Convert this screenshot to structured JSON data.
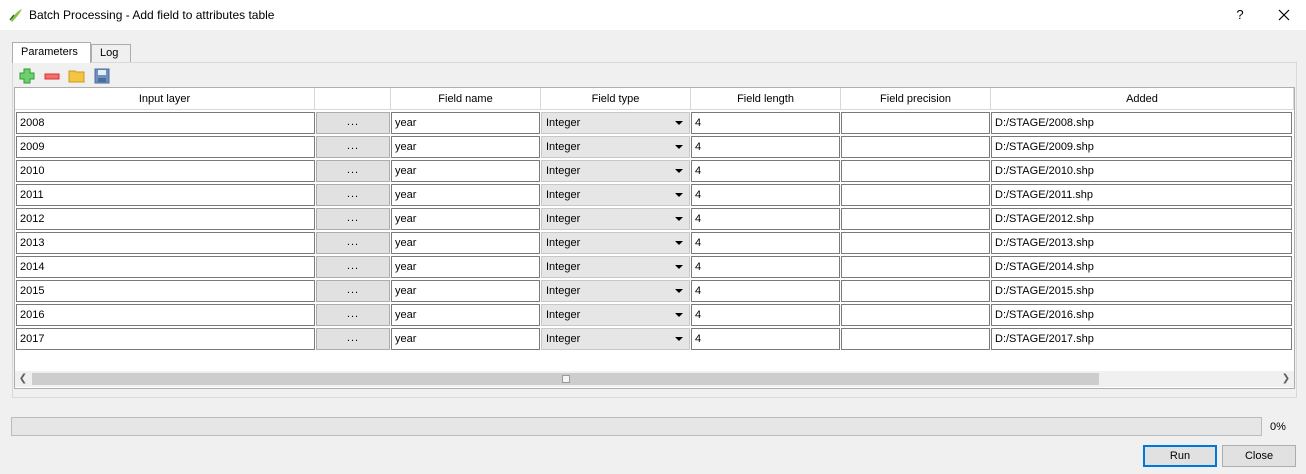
{
  "window": {
    "title": "Batch Processing - Add field to attributes table",
    "help_label": "?",
    "close_label": "✕"
  },
  "tabs": [
    {
      "label": "Parameters",
      "active": true
    },
    {
      "label": "Log",
      "active": false
    }
  ],
  "toolbar": {
    "icons": [
      "add-row-icon",
      "remove-row-icon",
      "open-folder-icon",
      "save-icon"
    ]
  },
  "table": {
    "columns": [
      "Input layer",
      "",
      "Field name",
      "Field type",
      "Field length",
      "Field precision",
      "Added"
    ],
    "browse_label": "...",
    "rows": [
      {
        "input": "2008",
        "field_name": "year",
        "field_type": "Integer",
        "field_length": "4",
        "field_precision": "",
        "added": "D:/STAGE/2008.shp"
      },
      {
        "input": "2009",
        "field_name": "year",
        "field_type": "Integer",
        "field_length": "4",
        "field_precision": "",
        "added": "D:/STAGE/2009.shp"
      },
      {
        "input": "2010",
        "field_name": "year",
        "field_type": "Integer",
        "field_length": "4",
        "field_precision": "",
        "added": "D:/STAGE/2010.shp"
      },
      {
        "input": "2011",
        "field_name": "year",
        "field_type": "Integer",
        "field_length": "4",
        "field_precision": "",
        "added": "D:/STAGE/2011.shp"
      },
      {
        "input": "2012",
        "field_name": "year",
        "field_type": "Integer",
        "field_length": "4",
        "field_precision": "",
        "added": "D:/STAGE/2012.shp"
      },
      {
        "input": "2013",
        "field_name": "year",
        "field_type": "Integer",
        "field_length": "4",
        "field_precision": "",
        "added": "D:/STAGE/2013.shp"
      },
      {
        "input": "2014",
        "field_name": "year",
        "field_type": "Integer",
        "field_length": "4",
        "field_precision": "",
        "added": "D:/STAGE/2014.shp"
      },
      {
        "input": "2015",
        "field_name": "year",
        "field_type": "Integer",
        "field_length": "4",
        "field_precision": "",
        "added": "D:/STAGE/2015.shp"
      },
      {
        "input": "2016",
        "field_name": "year",
        "field_type": "Integer",
        "field_length": "4",
        "field_precision": "",
        "added": "D:/STAGE/2016.shp"
      },
      {
        "input": "2017",
        "field_name": "year",
        "field_type": "Integer",
        "field_length": "4",
        "field_precision": "",
        "added": "D:/STAGE/2017.shp"
      }
    ]
  },
  "progress": {
    "value": 0,
    "text": "0%"
  },
  "buttons": {
    "run_label": "Run",
    "close_label": "Close"
  },
  "colors": {
    "accent": "#0078d7",
    "add_icon": "#2d9d2d",
    "remove_icon": "#e03030",
    "folder_icon": "#f4c542",
    "save_icon": "#4a6d9c"
  }
}
